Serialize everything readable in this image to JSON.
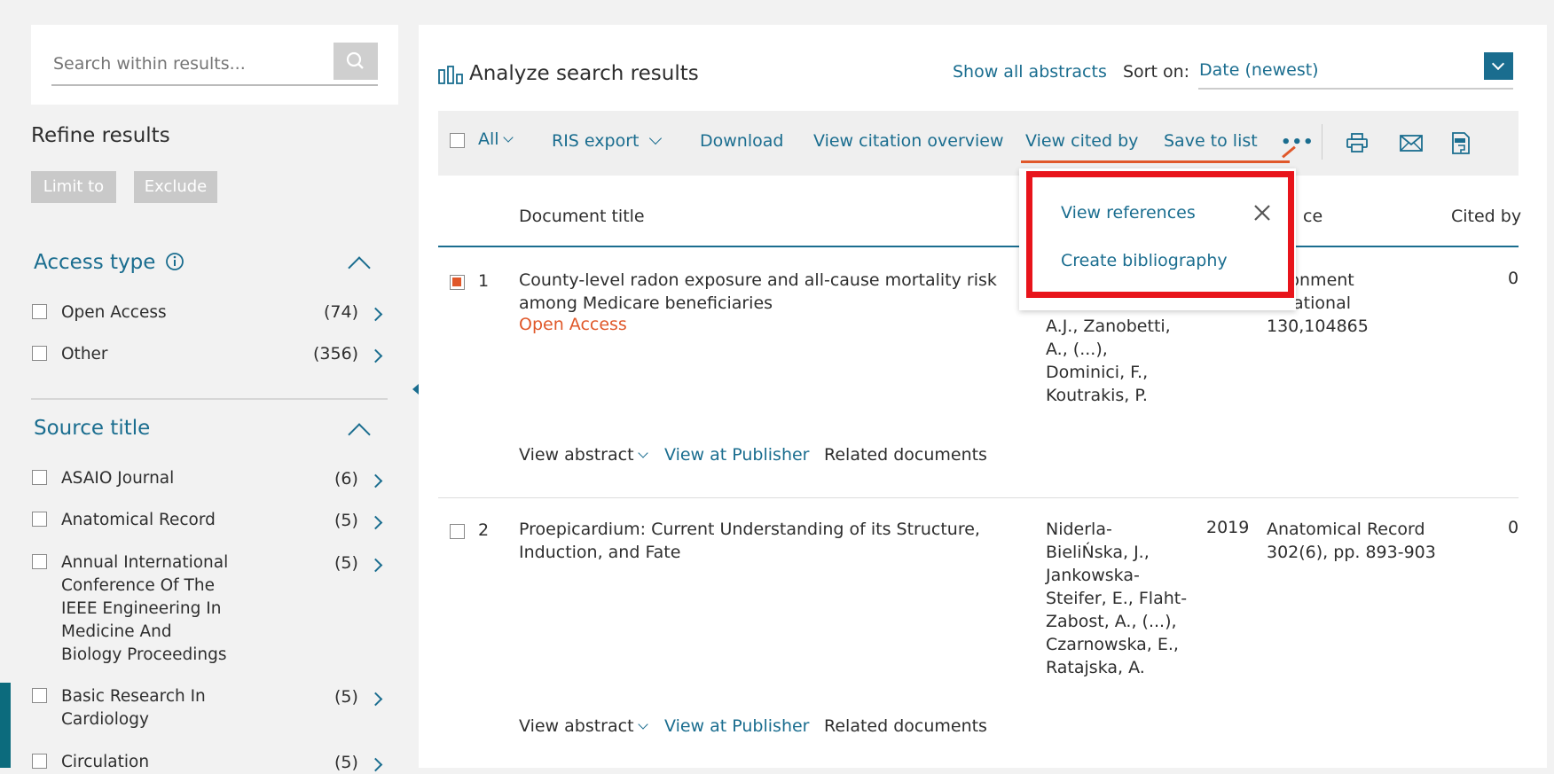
{
  "sidebar": {
    "search_placeholder": "Search within results...",
    "refine_title": "Refine results",
    "limit_label": "Limit to",
    "exclude_label": "Exclude",
    "access_type": {
      "title": "Access type",
      "items": [
        {
          "label": "Open Access",
          "count": "(74)"
        },
        {
          "label": "Other",
          "count": "(356)"
        }
      ]
    },
    "source_title": {
      "title": "Source title",
      "items": [
        {
          "label": "ASAIO Journal",
          "count": "(6)"
        },
        {
          "label": "Anatomical Record",
          "count": "(5)"
        },
        {
          "label_lines": [
            "Annual International",
            "Conference Of The",
            "IEEE Engineering In",
            "Medicine And",
            "Biology Proceedings"
          ],
          "count": "(5)"
        },
        {
          "label_lines": [
            "Basic Research In",
            "Cardiology"
          ],
          "count": "(5)"
        },
        {
          "label": "Circulation",
          "count": "(5)"
        }
      ]
    }
  },
  "header": {
    "analyze_label": "Analyze search results",
    "show_abstracts": "Show all abstracts",
    "sort_label": "Sort on:",
    "sort_value": "Date (newest)"
  },
  "toolbar": {
    "all_label": "All",
    "ris_export": "RIS export",
    "download": "Download",
    "citation_overview": "View citation overview",
    "cited_by": "View cited by",
    "save_to_list": "Save to list",
    "more": "•••"
  },
  "dropdown": {
    "view_references": "View references",
    "create_bibliography": "Create bibliography"
  },
  "table": {
    "col_title": "Document title",
    "col_source_partial": "ce",
    "col_cited": "Cited by",
    "rows": [
      {
        "num": "1",
        "checked": true,
        "title_lines": [
          "County-level radon exposure and all-cause mortality risk",
          "among Medicare beneficiaries"
        ],
        "access": "Open Access",
        "authors_partial": "A.J., Zanobetti,",
        "authors_lines": [
          "A., (...),",
          "Dominici, F.,",
          "Koutrakis, P."
        ],
        "source_lines": [
          "ronment",
          "national",
          "130,104865"
        ],
        "cited": "0",
        "view_abstract": "View abstract",
        "view_publisher": "View at Publisher",
        "related": "Related documents"
      },
      {
        "num": "2",
        "checked": false,
        "title_lines": [
          "Proepicardium: Current Understanding of its Structure,",
          "Induction, and Fate"
        ],
        "authors_lines": [
          "Niderla-",
          "BieliŃska, J.,",
          "Jankowska-",
          "Steifer, E., Flaht-",
          "Zabost, A., (...),",
          "Czarnowska, E.,",
          "Ratajska, A."
        ],
        "year": "2019",
        "source_lines": [
          "Anatomical Record",
          "302(6), pp. 893-903"
        ],
        "cited": "0",
        "view_abstract": "View abstract",
        "view_publisher": "View at Publisher",
        "related": "Related documents"
      }
    ]
  },
  "colors": {
    "link": "#1a6d8f",
    "accent_orange": "#e0582a",
    "highlight_red": "#e8141b",
    "sort_button": "#1a6d8f"
  }
}
